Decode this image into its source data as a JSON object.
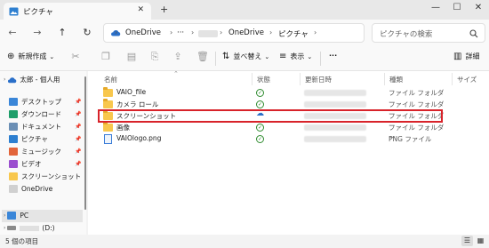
{
  "window": {
    "tab_title": "ピクチャ",
    "tab_close": "✕",
    "new_tab": "+",
    "minimize": "—",
    "maximize": "☐",
    "close": "✕"
  },
  "nav": {
    "back": "←",
    "forward": "→",
    "up": "↑",
    "refresh": "↻",
    "breadcrumb": [
      "OneDrive",
      "···",
      "OneDrive",
      "ピクチャ"
    ],
    "search_placeholder": "ピクチャの検索"
  },
  "toolbar": {
    "new_label": "新規作成",
    "sort_label": "並べ替え",
    "view_label": "表示",
    "more_label": "···",
    "details_label": "詳細"
  },
  "sidebar": {
    "account": "太郎 - 個人用",
    "items": [
      {
        "label": "デスクトップ",
        "icon": "desktop-icon",
        "color": "#3a86d8",
        "pinned": true
      },
      {
        "label": "ダウンロード",
        "icon": "download-icon",
        "color": "#1e9e6a",
        "pinned": true
      },
      {
        "label": "ドキュメント",
        "icon": "document-icon",
        "color": "#6b8fb5",
        "pinned": true
      },
      {
        "label": "ピクチャ",
        "icon": "picture-icon",
        "color": "#2d7fd0",
        "pinned": true
      },
      {
        "label": "ミュージック",
        "icon": "music-icon",
        "color": "#e2643a",
        "pinned": true
      },
      {
        "label": "ビデオ",
        "icon": "video-icon",
        "color": "#9b4fcf",
        "pinned": true
      },
      {
        "label": "スクリーンショット",
        "icon": "folder-icon",
        "color": "#f8c74d",
        "pinned": false
      },
      {
        "label": "OneDrive",
        "icon": "document-icon",
        "color": "#d0d0d0",
        "pinned": false
      }
    ],
    "pc_label": "PC",
    "drive_label": "(D:)"
  },
  "columns": {
    "name": "名前",
    "status": "状態",
    "date": "更新日時",
    "type": "種類",
    "size": "サイズ"
  },
  "files": [
    {
      "name": "VAIO_file",
      "kind": "folder",
      "status": "synced",
      "type": "ファイル フォルダー"
    },
    {
      "name": "カメラ ロール",
      "kind": "folder",
      "status": "synced",
      "type": "ファイル フォルダー"
    },
    {
      "name": "スクリーンショット",
      "kind": "folder",
      "status": "cloud",
      "type": "ファイル フォルダー"
    },
    {
      "name": "画像",
      "kind": "folder",
      "status": "synced",
      "type": "ファイル フォルダー"
    },
    {
      "name": "VAIOlogo.png",
      "kind": "file",
      "status": "synced",
      "type": "PNG ファイル"
    }
  ],
  "statusbar": {
    "item_count": "5 個の項目"
  },
  "colors": {
    "highlight": "#d8232a",
    "folder": "#f8c74d",
    "synced": "#2e8b2e",
    "cloud": "#2a6fc9"
  }
}
